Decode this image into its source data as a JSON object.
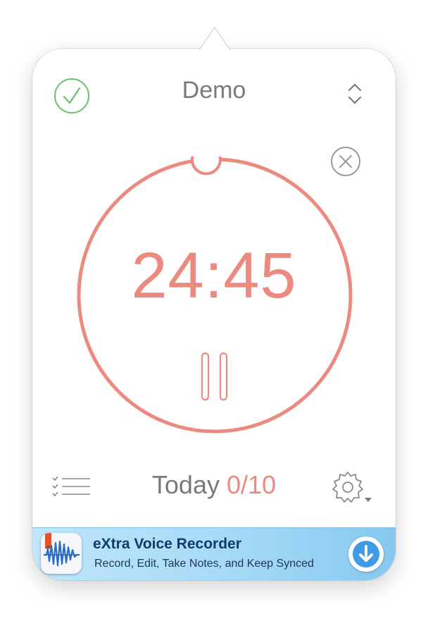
{
  "header": {
    "title": "Demo",
    "complete_icon": "checkmark-circle-icon",
    "switch_icon": "up-down-chevron-icon"
  },
  "timer": {
    "time": "24:45",
    "progress_fraction": 0.01,
    "reset_icon": "close-circle-icon",
    "pause_icon": "pause-icon"
  },
  "footer": {
    "today_label": "Today",
    "today_count": "0/10",
    "list_icon": "checklist-icon",
    "settings_icon": "gear-icon"
  },
  "ad": {
    "app_name": "eXtra Voice Recorder",
    "tagline": "Record, Edit, Take Notes, and Keep Synced",
    "download_icon": "download-arrow-icon"
  },
  "colors": {
    "accent": "#ec8a80",
    "check_green": "#6cc06c",
    "text_gray": "#7a7a7a",
    "ad_title": "#123a6a"
  }
}
